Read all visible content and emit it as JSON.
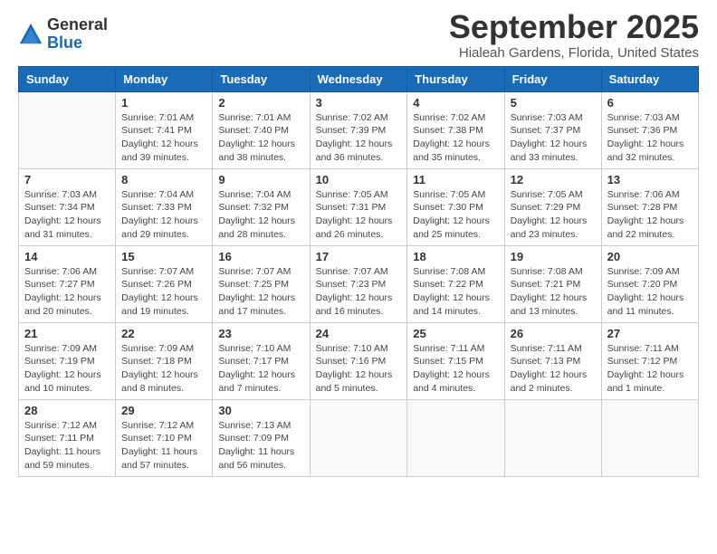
{
  "logo": {
    "general": "General",
    "blue": "Blue"
  },
  "title": "September 2025",
  "location": "Hialeah Gardens, Florida, United States",
  "days_of_week": [
    "Sunday",
    "Monday",
    "Tuesday",
    "Wednesday",
    "Thursday",
    "Friday",
    "Saturday"
  ],
  "weeks": [
    [
      {
        "day": "",
        "info": ""
      },
      {
        "day": "1",
        "info": "Sunrise: 7:01 AM\nSunset: 7:41 PM\nDaylight: 12 hours\nand 39 minutes."
      },
      {
        "day": "2",
        "info": "Sunrise: 7:01 AM\nSunset: 7:40 PM\nDaylight: 12 hours\nand 38 minutes."
      },
      {
        "day": "3",
        "info": "Sunrise: 7:02 AM\nSunset: 7:39 PM\nDaylight: 12 hours\nand 36 minutes."
      },
      {
        "day": "4",
        "info": "Sunrise: 7:02 AM\nSunset: 7:38 PM\nDaylight: 12 hours\nand 35 minutes."
      },
      {
        "day": "5",
        "info": "Sunrise: 7:03 AM\nSunset: 7:37 PM\nDaylight: 12 hours\nand 33 minutes."
      },
      {
        "day": "6",
        "info": "Sunrise: 7:03 AM\nSunset: 7:36 PM\nDaylight: 12 hours\nand 32 minutes."
      }
    ],
    [
      {
        "day": "7",
        "info": "Sunrise: 7:03 AM\nSunset: 7:34 PM\nDaylight: 12 hours\nand 31 minutes."
      },
      {
        "day": "8",
        "info": "Sunrise: 7:04 AM\nSunset: 7:33 PM\nDaylight: 12 hours\nand 29 minutes."
      },
      {
        "day": "9",
        "info": "Sunrise: 7:04 AM\nSunset: 7:32 PM\nDaylight: 12 hours\nand 28 minutes."
      },
      {
        "day": "10",
        "info": "Sunrise: 7:05 AM\nSunset: 7:31 PM\nDaylight: 12 hours\nand 26 minutes."
      },
      {
        "day": "11",
        "info": "Sunrise: 7:05 AM\nSunset: 7:30 PM\nDaylight: 12 hours\nand 25 minutes."
      },
      {
        "day": "12",
        "info": "Sunrise: 7:05 AM\nSunset: 7:29 PM\nDaylight: 12 hours\nand 23 minutes."
      },
      {
        "day": "13",
        "info": "Sunrise: 7:06 AM\nSunset: 7:28 PM\nDaylight: 12 hours\nand 22 minutes."
      }
    ],
    [
      {
        "day": "14",
        "info": "Sunrise: 7:06 AM\nSunset: 7:27 PM\nDaylight: 12 hours\nand 20 minutes."
      },
      {
        "day": "15",
        "info": "Sunrise: 7:07 AM\nSunset: 7:26 PM\nDaylight: 12 hours\nand 19 minutes."
      },
      {
        "day": "16",
        "info": "Sunrise: 7:07 AM\nSunset: 7:25 PM\nDaylight: 12 hours\nand 17 minutes."
      },
      {
        "day": "17",
        "info": "Sunrise: 7:07 AM\nSunset: 7:23 PM\nDaylight: 12 hours\nand 16 minutes."
      },
      {
        "day": "18",
        "info": "Sunrise: 7:08 AM\nSunset: 7:22 PM\nDaylight: 12 hours\nand 14 minutes."
      },
      {
        "day": "19",
        "info": "Sunrise: 7:08 AM\nSunset: 7:21 PM\nDaylight: 12 hours\nand 13 minutes."
      },
      {
        "day": "20",
        "info": "Sunrise: 7:09 AM\nSunset: 7:20 PM\nDaylight: 12 hours\nand 11 minutes."
      }
    ],
    [
      {
        "day": "21",
        "info": "Sunrise: 7:09 AM\nSunset: 7:19 PM\nDaylight: 12 hours\nand 10 minutes."
      },
      {
        "day": "22",
        "info": "Sunrise: 7:09 AM\nSunset: 7:18 PM\nDaylight: 12 hours\nand 8 minutes."
      },
      {
        "day": "23",
        "info": "Sunrise: 7:10 AM\nSunset: 7:17 PM\nDaylight: 12 hours\nand 7 minutes."
      },
      {
        "day": "24",
        "info": "Sunrise: 7:10 AM\nSunset: 7:16 PM\nDaylight: 12 hours\nand 5 minutes."
      },
      {
        "day": "25",
        "info": "Sunrise: 7:11 AM\nSunset: 7:15 PM\nDaylight: 12 hours\nand 4 minutes."
      },
      {
        "day": "26",
        "info": "Sunrise: 7:11 AM\nSunset: 7:13 PM\nDaylight: 12 hours\nand 2 minutes."
      },
      {
        "day": "27",
        "info": "Sunrise: 7:11 AM\nSunset: 7:12 PM\nDaylight: 12 hours\nand 1 minute."
      }
    ],
    [
      {
        "day": "28",
        "info": "Sunrise: 7:12 AM\nSunset: 7:11 PM\nDaylight: 11 hours\nand 59 minutes."
      },
      {
        "day": "29",
        "info": "Sunrise: 7:12 AM\nSunset: 7:10 PM\nDaylight: 11 hours\nand 57 minutes."
      },
      {
        "day": "30",
        "info": "Sunrise: 7:13 AM\nSunset: 7:09 PM\nDaylight: 11 hours\nand 56 minutes."
      },
      {
        "day": "",
        "info": ""
      },
      {
        "day": "",
        "info": ""
      },
      {
        "day": "",
        "info": ""
      },
      {
        "day": "",
        "info": ""
      }
    ]
  ]
}
